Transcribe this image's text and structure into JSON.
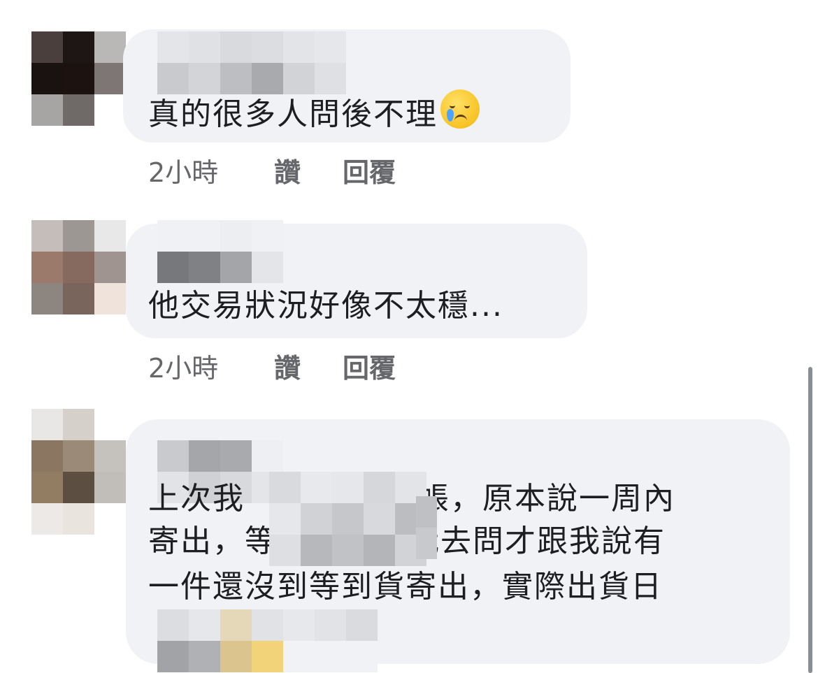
{
  "comments": [
    {
      "text": "真的很多人問後不理",
      "emoji": "tearful-smile-emoji",
      "time": "2小時",
      "like": "讚",
      "reply": "回覆"
    },
    {
      "text": "他交易狀況好像不太穩...",
      "time": "2小時",
      "like": "讚",
      "reply": "回覆"
    },
    {
      "lines": [
        "上次我",
        "帳，原本說一周內",
        "寄出，等",
        "我去問才跟我說有",
        "一件還沒到等到貨寄出，實際出貨日"
      ]
    }
  ],
  "colors": {
    "bubble": "#f0f2f5",
    "meta_text": "#65676b",
    "text": "#1c1e21"
  }
}
